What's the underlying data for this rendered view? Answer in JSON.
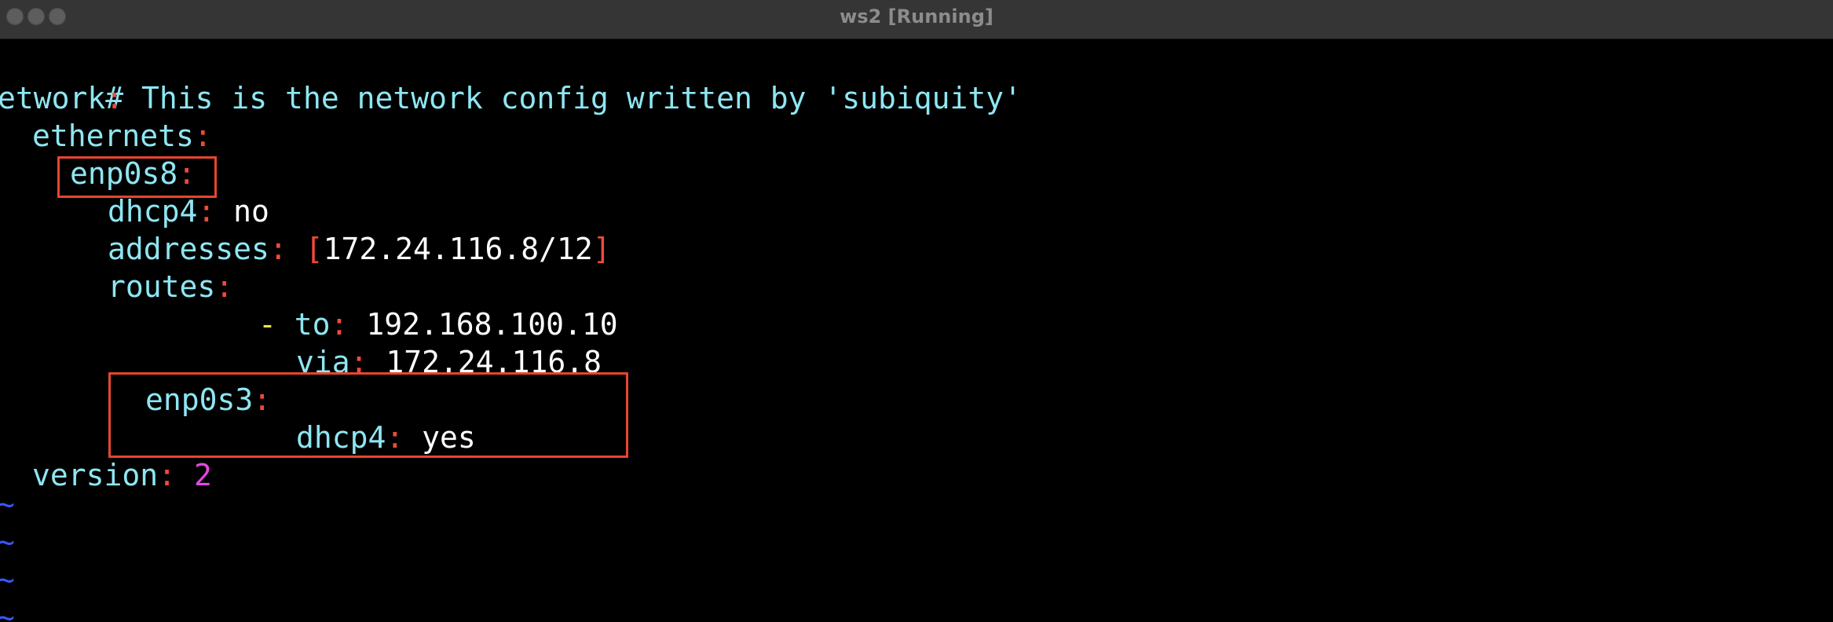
{
  "window": {
    "title": "ws2 [Running]"
  },
  "editor": {
    "comment": "# This is the network config written by 'subiquity'",
    "network_key": "etwork",
    "network_colon": ":",
    "ethernets_key": "ethernets",
    "ethernets_colon": ":",
    "iface1_key": "enp0s8",
    "iface1_colon": ":",
    "dhcp4_1_key": "dhcp4",
    "dhcp4_1_colon": ":",
    "dhcp4_1_value": "no",
    "addresses_key": "addresses",
    "addresses_colon": ":",
    "bracket_open": "[",
    "address_value": "172.24.116.8/12",
    "bracket_close": "]",
    "routes_key": "routes",
    "routes_colon": ":",
    "route_dash": "-",
    "to_key": "to",
    "to_colon": ":",
    "to_value": "192.168.100.10",
    "via_key": "via",
    "via_colon": ":",
    "via_value": "172.24.116.8",
    "iface2_key": "enp0s3",
    "iface2_colon": ":",
    "dhcp4_2_key": "dhcp4",
    "dhcp4_2_colon": ":",
    "dhcp4_2_value": "yes",
    "version_key": "version",
    "version_colon": ":",
    "version_value": "2",
    "tilde": "~"
  },
  "colors": {
    "key": "#8ee6f2",
    "punct": "#f04a3a",
    "number": "#e24ae0",
    "dash": "#f6e34a",
    "tilde": "#3a57ff",
    "highlight_box": "#e8452f"
  }
}
